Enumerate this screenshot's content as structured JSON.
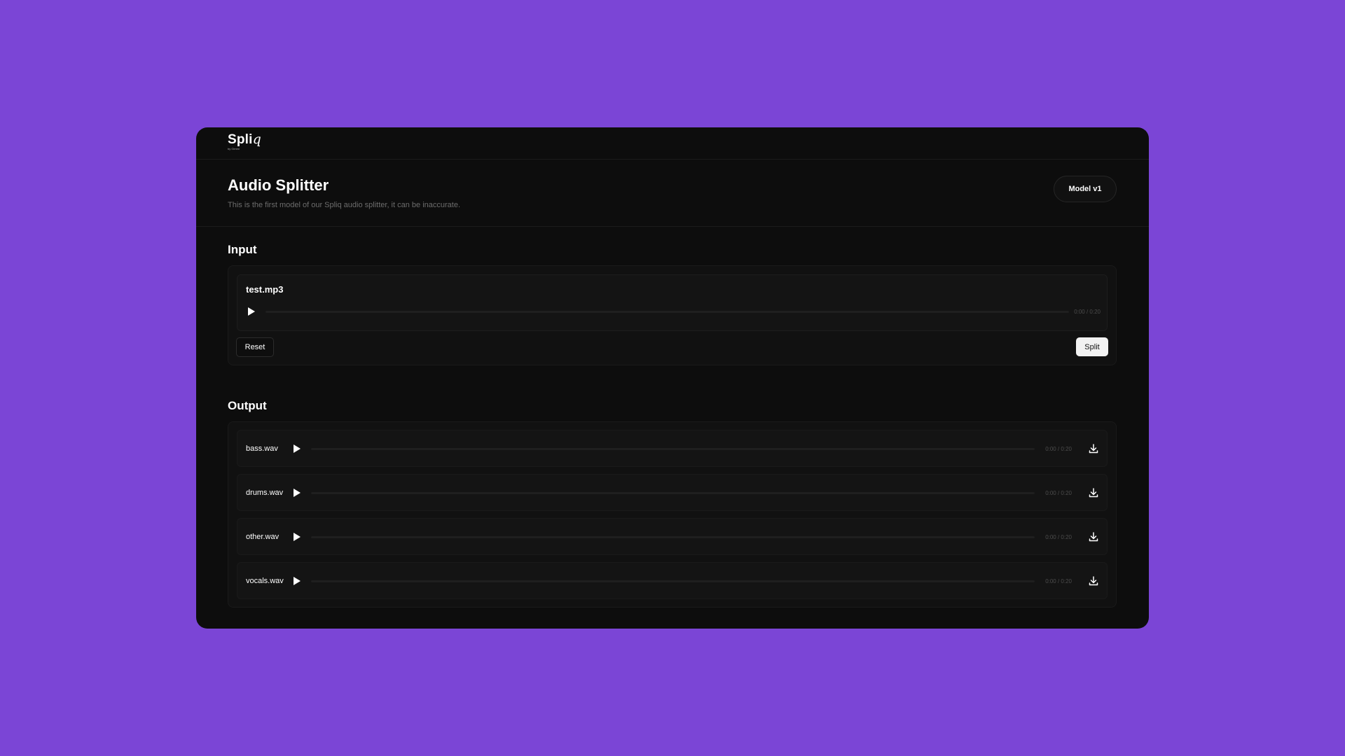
{
  "app": {
    "logo_text": "Spli",
    "logo_q": "q",
    "logo_sub": "by Gimmi"
  },
  "header": {
    "title": "Audio Splitter",
    "description": "This is the first model of our Spliq audio splitter, it can be inaccurate.",
    "model_label": "Model v1"
  },
  "input": {
    "section_title": "Input",
    "file_name": "test.mp3",
    "time": "0:00 / 0:20",
    "progress": 0,
    "reset_label": "Reset",
    "split_label": "Split"
  },
  "output": {
    "section_title": "Output",
    "files": [
      {
        "name": "bass.wav",
        "time": "0:00 / 0:20",
        "progress": 0
      },
      {
        "name": "drums.wav",
        "time": "0:00 / 0:20",
        "progress": 0
      },
      {
        "name": "other.wav",
        "time": "0:00 / 0:20",
        "progress": 0
      },
      {
        "name": "vocals.wav",
        "time": "0:00 / 0:20",
        "progress": 0
      }
    ]
  },
  "colors": {
    "background": "#7b45d6",
    "panel": "#0d0d0d",
    "card": "#111111",
    "accent_button": "#f2f2f2"
  },
  "icons": {
    "play": "play-icon",
    "download": "download-icon"
  }
}
